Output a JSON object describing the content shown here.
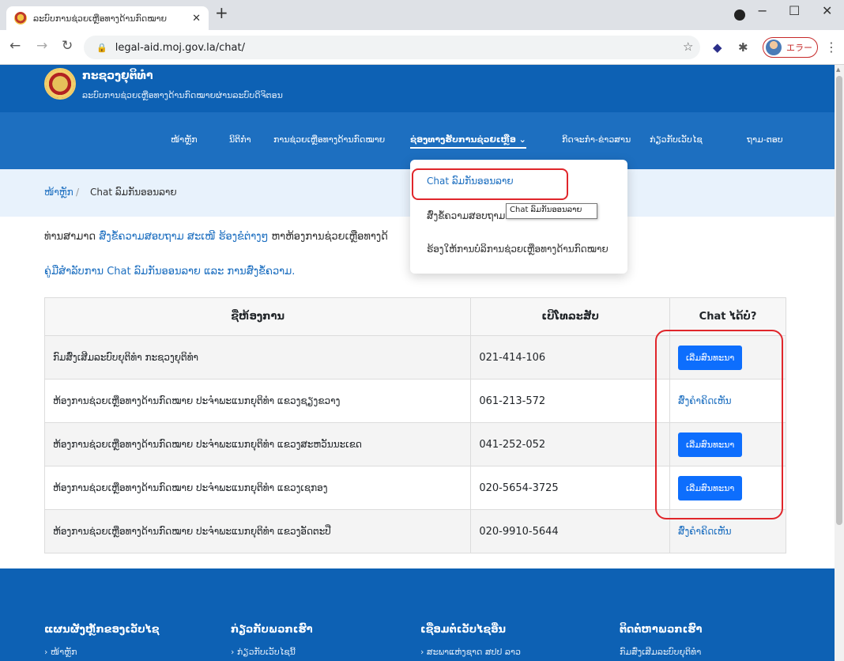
{
  "browser": {
    "tab_title": "ລະບົບການຊ່ວຍເຫຼືອທາງດ້ານກົດໝາຍ",
    "tab_close": "✕",
    "new_tab": "+",
    "url": "legal-aid.moj.gov.la/chat/",
    "user_name": "エラー",
    "window": {
      "minimize": "−",
      "maximize": "☐",
      "close": "✕"
    }
  },
  "site": {
    "title": "ກະຊວງຍຸຕິທຳ",
    "subtitle": "ລະບົບການຊ່ວຍເຫຼືອທາງດ້ານກົດໝາຍຜ່ານລະບົບດິຈິຕອນ"
  },
  "nav": {
    "items": [
      {
        "label": "ໜ້າຫຼັກ"
      },
      {
        "label": "ນິຕິກຳ"
      },
      {
        "label": "ການຊ່ວຍເຫຼືອທາງດ້ານກົດໝາຍ"
      },
      {
        "label": "ຊ່ອງທາງຮັບການຊ່ວຍເຫຼືອ ⌄"
      },
      {
        "label": "ກິດຈະກຳ-ຂ່າວສານ"
      },
      {
        "label": "ກ່ຽວກັບເວັບໄຊ"
      },
      {
        "label": "ຖາມ-ຕອບ"
      }
    ]
  },
  "dropdown": {
    "items": [
      {
        "label": "Chat ລົມກັນອອນລາຍ"
      },
      {
        "label": "ສົ່ງຂໍ້ຄວາມສອບຖາມ"
      },
      {
        "label": "ຮ້ອງໃຫ້ການບໍລິການຊ່ວຍເຫຼືອທາງດ້ານກົດໝາຍ"
      }
    ],
    "tooltip": "Chat ລົມກັນອອນລາຍ"
  },
  "breadcrumb": {
    "home": "ໜ້າຫຼັກ",
    "separator": "/",
    "current": "Chat ລົມກັນອອນລາຍ"
  },
  "intro": {
    "prefix": "ທ່ານສາມາດ ",
    "link": "ສົ່ງຂໍ້ຄວາມສອບຖາມ ສະເໜີ ຮ້ອງຂໍຕ່າງໆ",
    "suffix": " ຫາຫ້ອງການຊ່ວຍເຫຼືອທາງດ້",
    "guide_link": "ຄູ່ມືສຳລັບການ Chat ລົມກັນອອນລາຍ ແລະ ການສົ່ງຂໍ້ຄວາມ."
  },
  "table": {
    "headers": [
      "ຊື່ຫ້ອງການ",
      "ເບີໂທລະສັບ",
      "Chat ໄດ້ບໍ່?"
    ],
    "rows": [
      {
        "office": "ກົມສົ່ງເສີມລະບົບຍຸຕິທຳ ກະຊວງຍຸຕິທຳ",
        "phone": "021-414-106",
        "action": "ເລີ່ມສົນທະນາ",
        "action_type": "button"
      },
      {
        "office": "ຫ້ອງການຊ່ວຍເຫຼືອທາງດ້ານກົດໝາຍ ປະຈຳພະແນກຍຸຕິທຳ ແຂວງຊຽງຂວາງ",
        "phone": "061-213-572",
        "action": "ສົ່ງຄຳຄິດເຫັນ",
        "action_type": "link"
      },
      {
        "office": "ຫ້ອງການຊ່ວຍເຫຼືອທາງດ້ານກົດໝາຍ ປະຈຳພະແນກຍຸຕິທຳ ແຂວງສະຫວັນນະເຂດ",
        "phone": "041-252-052",
        "action": "ເລີ່ມສົນທະນາ",
        "action_type": "button"
      },
      {
        "office": "ຫ້ອງການຊ່ວຍເຫຼືອທາງດ້ານກົດໝາຍ ປະຈຳພະແນກຍຸຕິທຳ ແຂວງເຊກອງ",
        "phone": "020-5654-3725",
        "action": "ເລີ່ມສົນທະນາ",
        "action_type": "button"
      },
      {
        "office": "ຫ້ອງການຊ່ວຍເຫຼືອທາງດ້ານກົດໝາຍ ປະຈຳພະແນກຍຸຕິທຳ ແຂວງອັດຕະປື",
        "phone": "020-9910-5644",
        "action": "ສົ່ງຄຳຄິດເຫັນ",
        "action_type": "link"
      }
    ]
  },
  "footer": {
    "columns": [
      {
        "title": "ແຜນຜັງຫຼັກຂອງເວັບໄຊ",
        "link": "› ໜ້າຫຼັກ"
      },
      {
        "title": "ກ່ຽວກັບພວກເຮົາ",
        "link": "› ກ່ຽວກັບເວັບໄຊນີ້"
      },
      {
        "title": "ເຊື່ອມຕໍ່ເວັບໄຊອື່ນ",
        "link": "› ສະພາແຫ່ງຊາດ ສປປ ລາວ"
      },
      {
        "title": "ຕິດຕໍ່ຫາພວກເຮົາ",
        "link": "ກົມສົ່ງເສີມລະບົບຍຸຕິທຳ"
      }
    ]
  },
  "colors": {
    "brand_blue": "#0d61b4",
    "nav_blue": "#1d6fc0",
    "button_blue": "#0d6efd",
    "highlight_red": "#e0262b"
  }
}
